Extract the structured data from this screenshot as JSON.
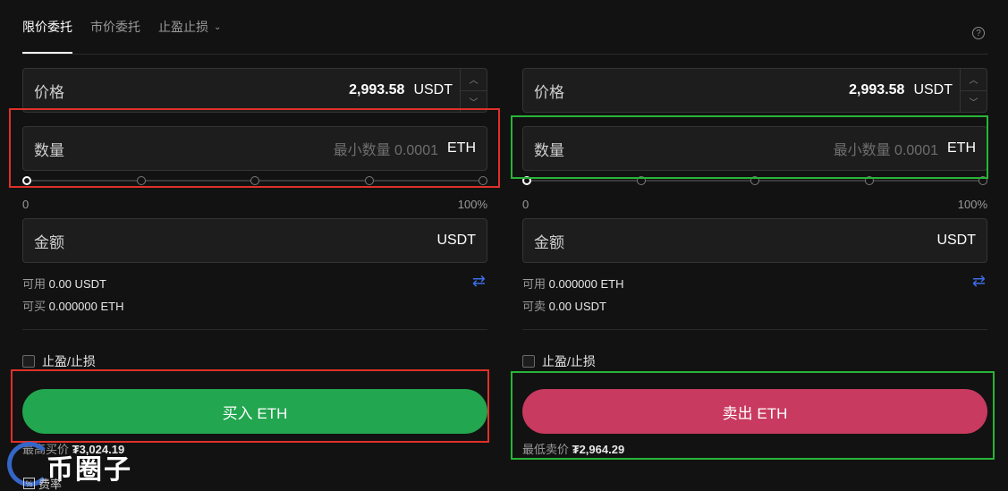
{
  "tabs": [
    {
      "label": "限价委托",
      "active": true
    },
    {
      "label": "市价委托",
      "active": false
    },
    {
      "label": "止盈止损",
      "active": false
    }
  ],
  "icons": {
    "help": "question-circle-icon",
    "swap": "swap-arrows-icon",
    "dropdown": "chevron-down-icon"
  },
  "colors": {
    "buy": "#22a650",
    "sell": "#c83a5f",
    "highlight_red": "#e0302a",
    "highlight_green": "#28b436",
    "link": "#3b6ee8"
  },
  "buy": {
    "price_label": "价格",
    "price_value": "2,993.58",
    "price_unit": "USDT",
    "qty_label": "数量",
    "qty_placeholder": "最小数量 0.0001",
    "qty_unit": "ETH",
    "slider_min": "0",
    "slider_max": "100%",
    "slider_value": 0,
    "amount_label": "金额",
    "amount_unit": "USDT",
    "avail_label": "可用",
    "avail_value": "0.00 USDT",
    "can_label": "可买",
    "can_value": "0.000000 ETH",
    "tpsl_label": "止盈/止损",
    "button_label": "买入 ETH",
    "limit_label": "最高买价",
    "limit_value": "₮3,024.19"
  },
  "sell": {
    "price_label": "价格",
    "price_value": "2,993.58",
    "price_unit": "USDT",
    "qty_label": "数量",
    "qty_placeholder": "最小数量 0.0001",
    "qty_unit": "ETH",
    "slider_min": "0",
    "slider_max": "100%",
    "slider_value": 0,
    "amount_label": "金额",
    "amount_unit": "USDT",
    "avail_label": "可用",
    "avail_value": "0.000000 ETH",
    "can_label": "可卖",
    "can_value": "0.00 USDT",
    "tpsl_label": "止盈/止损",
    "button_label": "卖出 ETH",
    "limit_label": "最低卖价",
    "limit_value": "₮2,964.29"
  },
  "footer": {
    "fee_label": "费率",
    "watermark_text": "币圈子"
  }
}
